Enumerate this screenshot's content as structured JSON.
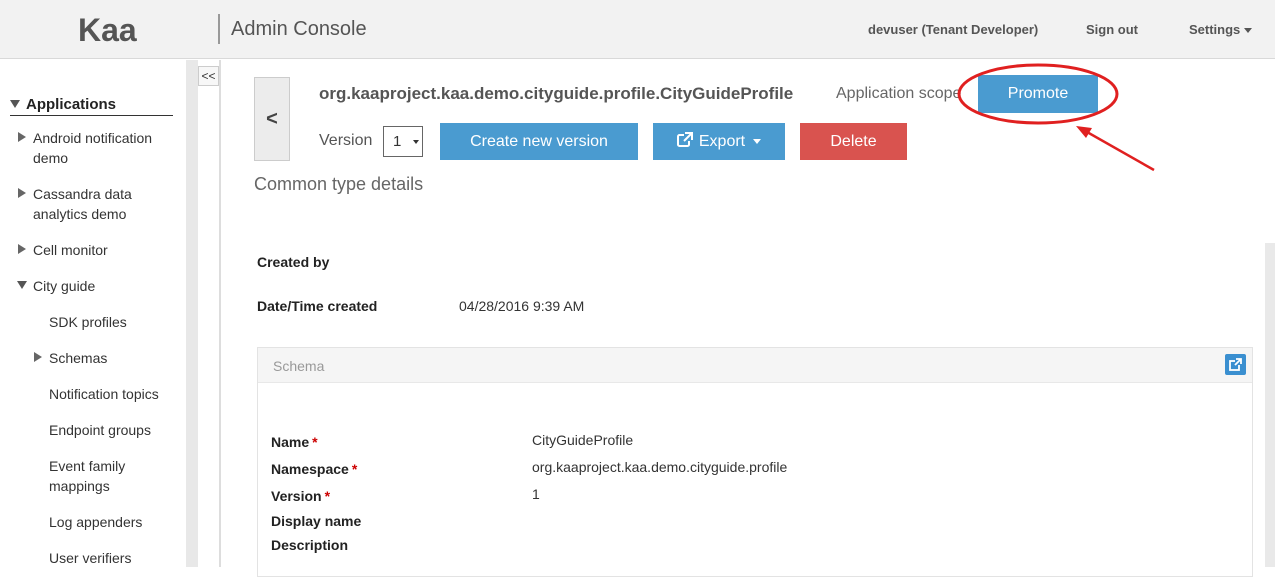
{
  "header": {
    "logo": "Kaa",
    "title": "Admin Console",
    "user": "devuser (Tenant Developer)",
    "sign_out": "Sign out",
    "settings": "Settings"
  },
  "sidebar": {
    "collapse_label": "<<",
    "section": "Applications",
    "items": [
      {
        "label": "Android notification",
        "label2": "demo"
      },
      {
        "label": "Cassandra data",
        "label2": "analytics demo"
      },
      {
        "label": "Cell monitor"
      },
      {
        "label": "City guide"
      },
      {
        "label": "SDK profiles"
      },
      {
        "label": "Schemas"
      },
      {
        "label": "Notification topics"
      },
      {
        "label": "Endpoint groups"
      },
      {
        "label": "Event family",
        "label2": "mappings"
      },
      {
        "label": "Log appenders"
      },
      {
        "label": "User verifiers"
      }
    ]
  },
  "main": {
    "back_label": "<",
    "fqn": "org.kaaproject.kaa.demo.cityguide.profile.CityGuideProfile",
    "scope": "Application scope",
    "promote": "Promote",
    "version_label": "Version",
    "version_value": "1",
    "create_version": "Create new version",
    "export": "Export",
    "delete": "Delete",
    "section_title": "Common type details",
    "created_by_label": "Created by",
    "created_by_value": "",
    "datetime_label": "Date/Time created",
    "datetime_value": "04/28/2016 9:39 AM"
  },
  "schema": {
    "title": "Schema",
    "fields": [
      {
        "label": "Name",
        "required": "*",
        "value": "CityGuideProfile"
      },
      {
        "label": "Namespace",
        "required": "*",
        "value": "org.kaaproject.kaa.demo.cityguide.profile"
      },
      {
        "label": "Version",
        "required": "*",
        "value": "1"
      },
      {
        "label": "Display name",
        "required": "",
        "value": ""
      },
      {
        "label": "Description",
        "required": "",
        "value": ""
      }
    ]
  },
  "colors": {
    "primary": "#4a9bd0",
    "danger": "#d9534f",
    "annotation": "#e02020"
  },
  "icons": [
    "external-link-icon",
    "caret-down-icon",
    "triangle-right-icon",
    "triangle-down-icon"
  ]
}
